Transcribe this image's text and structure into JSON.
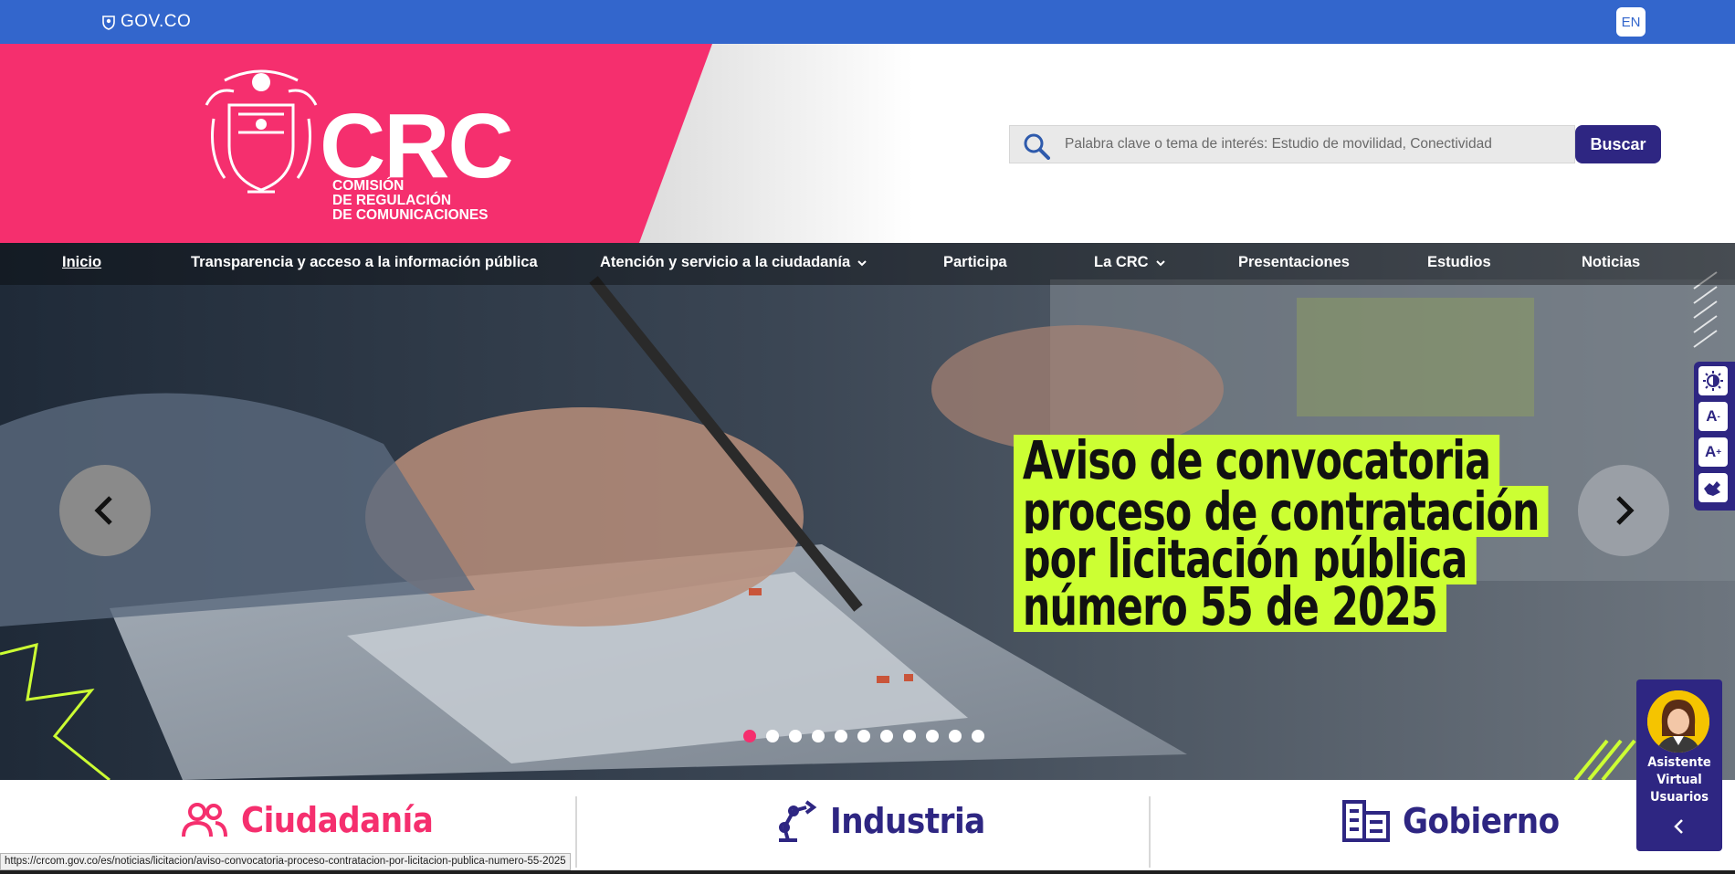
{
  "govbar": {
    "logo_text": "GOV.CO",
    "language_button": "EN"
  },
  "header": {
    "brand_acronym": "CRC",
    "brand_line1": "COMISIÓN",
    "brand_line2": "DE REGULACIÓN",
    "brand_line3": "DE COMUNICACIONES",
    "search_placeholder": "Palabra clave o tema de interés: Estudio de movilidad, Conectividad",
    "search_button": "Buscar"
  },
  "nav": {
    "items": [
      {
        "label": "Inicio",
        "active": true,
        "dropdown": false
      },
      {
        "label": "Transparencia y acceso a la información pública",
        "dropdown": false
      },
      {
        "label": "Atención y servicio a la ciudadanía",
        "dropdown": true
      },
      {
        "label": "Participa",
        "dropdown": false
      },
      {
        "label": "La CRC",
        "dropdown": true
      },
      {
        "label": "Presentaciones",
        "dropdown": false
      },
      {
        "label": "Estudios",
        "dropdown": false
      },
      {
        "label": "Noticias",
        "dropdown": false
      }
    ]
  },
  "hero": {
    "promo_lines": [
      "Aviso de convocatoria",
      "proceso de contratación",
      "por licitación pública",
      "número 55 de 2025"
    ],
    "promo_color": "#ccff33",
    "slide_count": 11,
    "active_slide": 1,
    "prev_icon": "chevron-left-icon",
    "next_icon": "chevron-right-icon"
  },
  "accessibility": {
    "contrast_icon": "contrast-icon",
    "decrease_font": "A",
    "increase_font": "A",
    "sign_language_icon": "sign-language-icon"
  },
  "categories": [
    {
      "label": "Ciudadanía",
      "icon": "people-icon",
      "color": "#f52f6e"
    },
    {
      "label": "Industria",
      "icon": "robot-arm-icon",
      "color": "#2e2682"
    },
    {
      "label": "Gobierno",
      "icon": "building-icon",
      "color": "#2e2682"
    }
  ],
  "assistant": {
    "line1": "Asistente",
    "line2": "Virtual",
    "line3": "Usuarios"
  },
  "status_url": "https://crcom.gov.co/es/noticias/licitacion/aviso-convocatoria-proceso-contratacion-por-licitacion-publica-numero-55-2025",
  "colors": {
    "govbar": "#3366cc",
    "brand_pink": "#f52f6e",
    "brand_navy": "#2e2682"
  }
}
